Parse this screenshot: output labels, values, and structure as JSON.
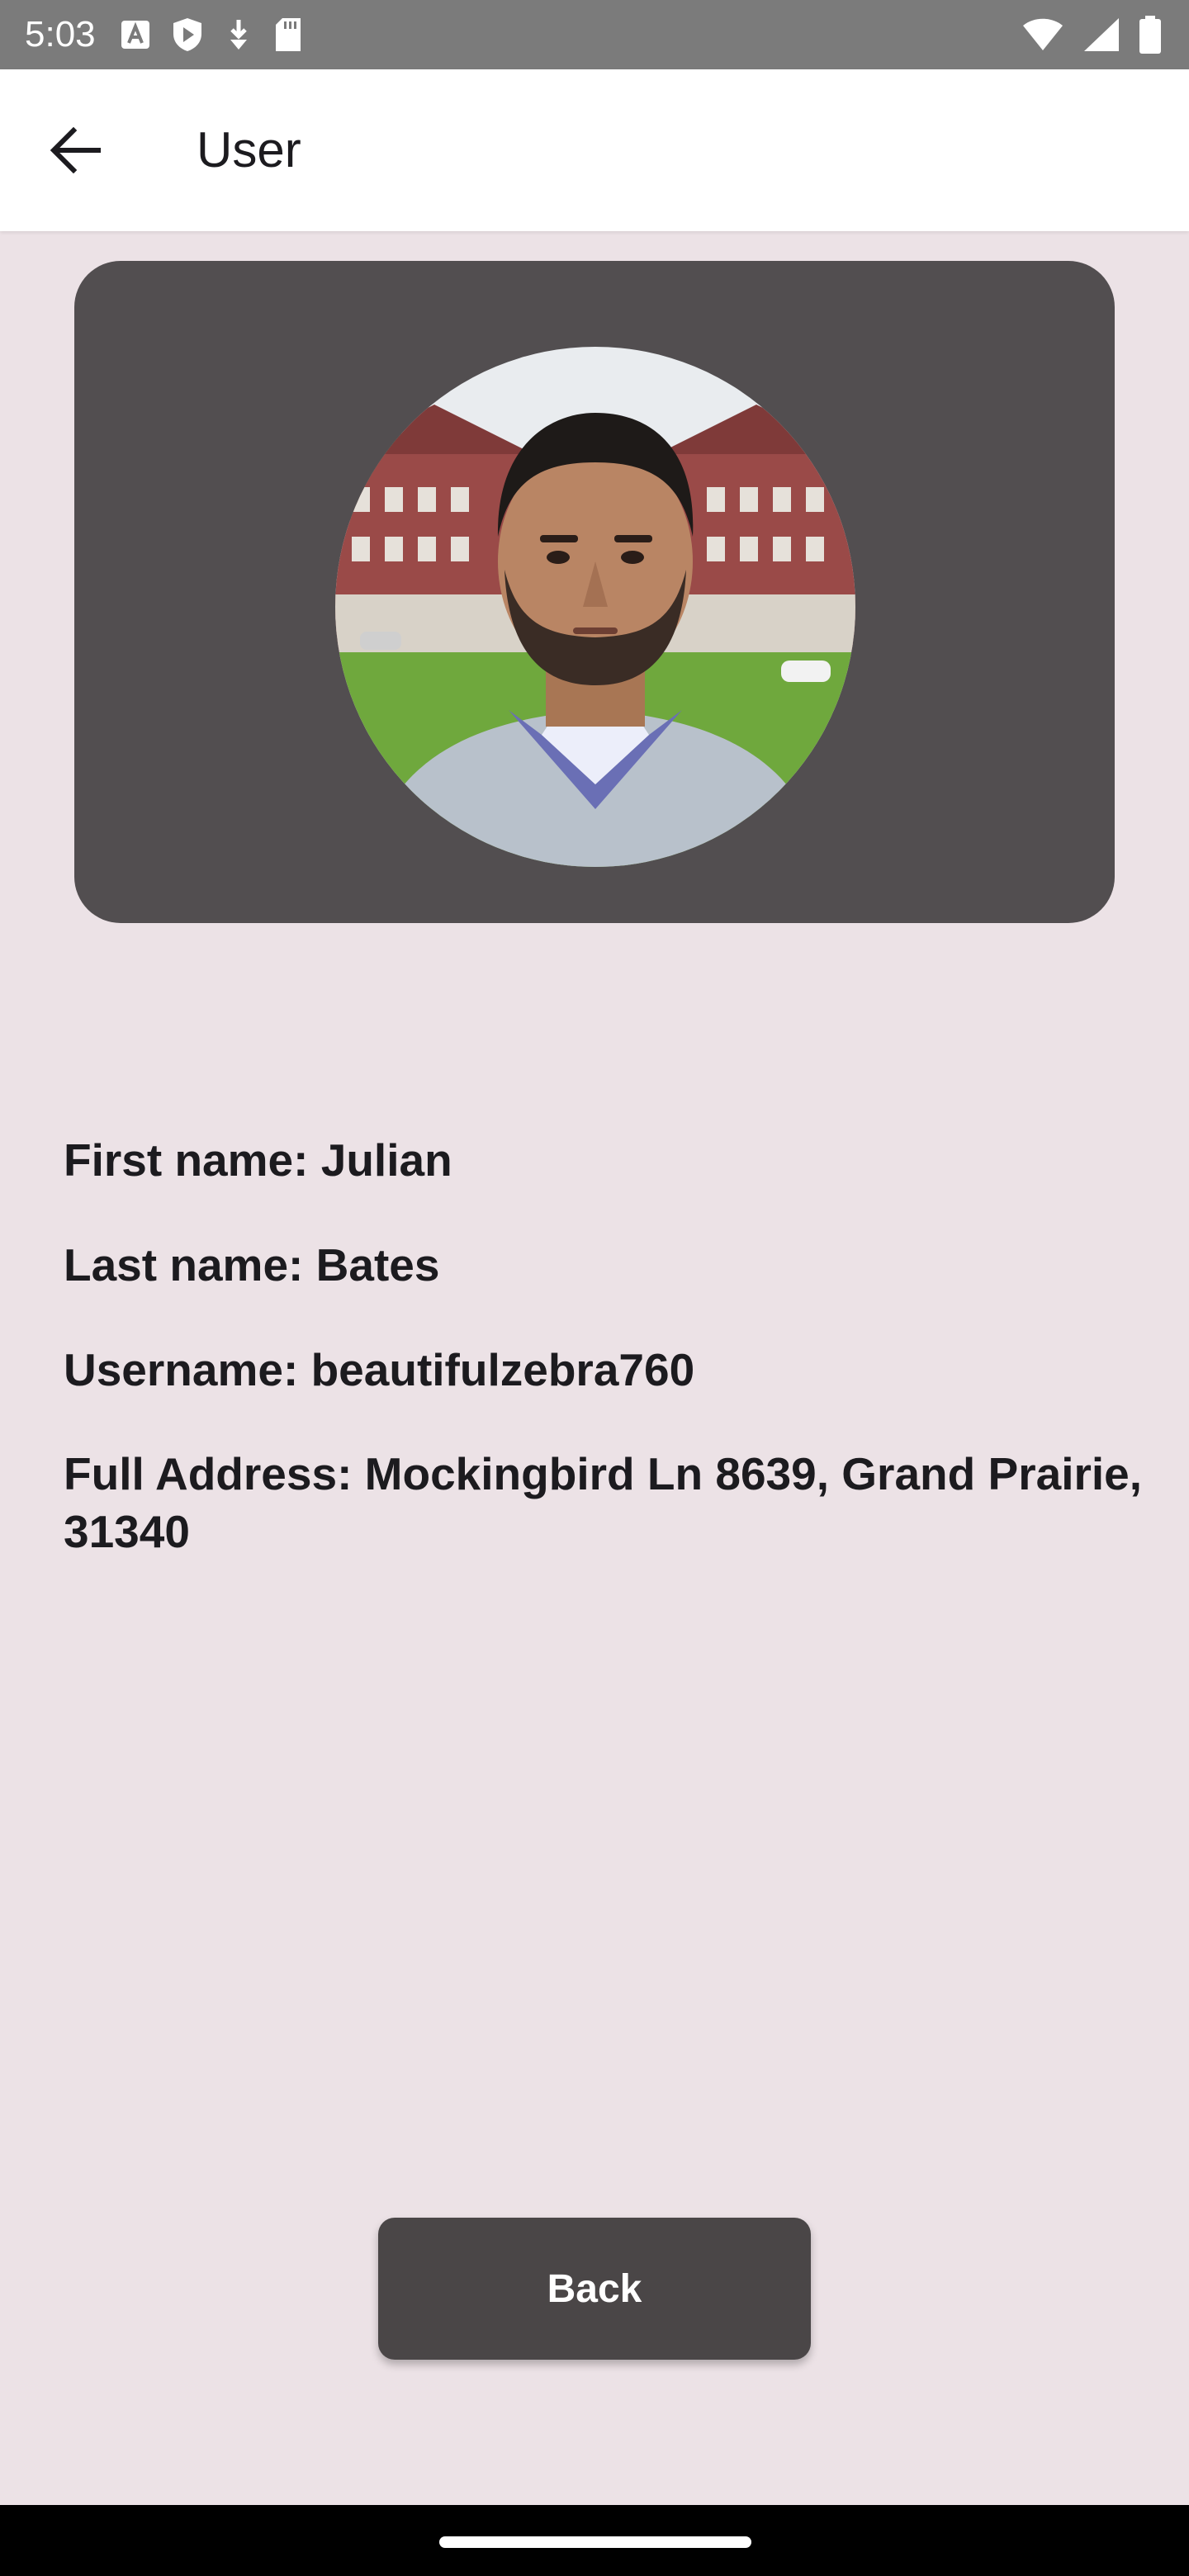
{
  "status_bar": {
    "time": "5:03",
    "left_icons": [
      "text-a-icon",
      "shield-play-icon",
      "usb-download-icon",
      "sd-card-icon"
    ],
    "right_icons": [
      "wifi-icon",
      "signal-icon",
      "battery-icon"
    ]
  },
  "app_bar": {
    "title": "User",
    "back_icon": "arrow-left-icon"
  },
  "profile": {
    "card_color": "#524e50",
    "avatar": "profile-photo"
  },
  "info": {
    "first_name": "First name: Julian",
    "last_name": "Last name: Bates",
    "username": "Username: beautifulzebra760",
    "address": "Full Address: Mockingbird Ln 8639, Grand Prairie, 31340"
  },
  "actions": {
    "back_label": "Back"
  },
  "colors": {
    "background": "#ece2e6",
    "button": "#4a4647",
    "status_bar": "#7b7b7b"
  }
}
